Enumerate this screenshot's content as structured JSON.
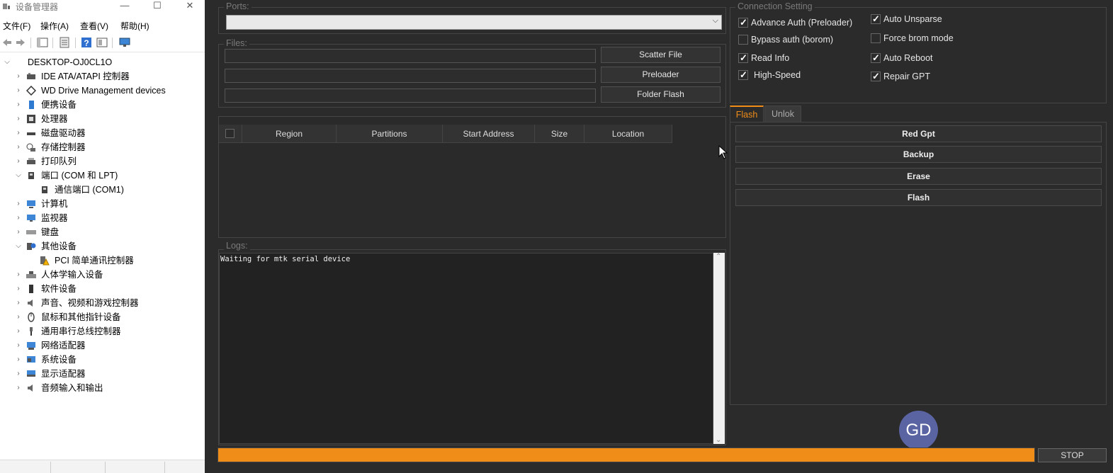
{
  "device_manager": {
    "title": "设备管理器",
    "window_buttons": {
      "minimize": "—",
      "maximize": "☐",
      "close": "✕"
    },
    "menu": [
      "文件(F)",
      "操作(A)",
      "查看(V)",
      "帮助(H)"
    ],
    "tree": [
      {
        "label": "DESKTOP-OJ0CL1O",
        "icon": "computer-icon",
        "expanded": true,
        "level": 0
      },
      {
        "label": "IDE ATA/ATAPI 控制器",
        "icon": "ide-icon",
        "level": 1
      },
      {
        "label": "WD Drive Management devices",
        "icon": "diamond-icon",
        "level": 1
      },
      {
        "label": "便携设备",
        "icon": "portable-device-icon",
        "level": 1
      },
      {
        "label": "处理器",
        "icon": "processor-icon",
        "level": 1
      },
      {
        "label": "磁盘驱动器",
        "icon": "disk-drive-icon",
        "level": 1
      },
      {
        "label": "存储控制器",
        "icon": "storage-controller-icon",
        "level": 1
      },
      {
        "label": "打印队列",
        "icon": "printer-icon",
        "level": 1
      },
      {
        "label": "端口 (COM 和 LPT)",
        "icon": "port-icon",
        "expanded": true,
        "level": 1
      },
      {
        "label": "通信端口 (COM1)",
        "icon": "com-port-icon",
        "level": 2
      },
      {
        "label": "计算机",
        "icon": "computer-icon",
        "level": 1
      },
      {
        "label": "监视器",
        "icon": "monitor-icon",
        "level": 1
      },
      {
        "label": "键盘",
        "icon": "keyboard-icon",
        "level": 1
      },
      {
        "label": "其他设备",
        "icon": "unknown-device-icon",
        "expanded": true,
        "level": 1
      },
      {
        "label": "PCI 简单通讯控制器",
        "icon": "warning-device-icon",
        "level": 2
      },
      {
        "label": "人体学输入设备",
        "icon": "hid-icon",
        "level": 1
      },
      {
        "label": "软件设备",
        "icon": "software-device-icon",
        "level": 1
      },
      {
        "label": "声音、视频和游戏控制器",
        "icon": "speaker-icon",
        "level": 1
      },
      {
        "label": "鼠标和其他指针设备",
        "icon": "mouse-icon",
        "level": 1
      },
      {
        "label": "通用串行总线控制器",
        "icon": "usb-icon",
        "level": 1
      },
      {
        "label": "网络适配器",
        "icon": "network-icon",
        "level": 1
      },
      {
        "label": "系统设备",
        "icon": "system-device-icon",
        "level": 1
      },
      {
        "label": "显示适配器",
        "icon": "display-adapter-icon",
        "level": 1
      },
      {
        "label": "音频输入和输出",
        "icon": "audio-icon",
        "level": 1
      }
    ]
  },
  "tool": {
    "ports": {
      "title": "Ports:",
      "selected": ""
    },
    "files": {
      "title": "Files:",
      "rows": [
        {
          "value": "",
          "button": "Scatter File"
        },
        {
          "value": "",
          "button": "Preloader"
        },
        {
          "value": "",
          "button": "Folder Flash"
        }
      ]
    },
    "partitions_table": {
      "columns": [
        "Region",
        "Partitions",
        "Start Address",
        "Size",
        "Location"
      ]
    },
    "logs": {
      "title": "Logs:",
      "lines": [
        "Waiting for mtk serial device"
      ]
    },
    "connection": {
      "title": "Connection Setting",
      "options": [
        {
          "label": "Advance Auth (Preloader)",
          "checked": true
        },
        {
          "label": "Auto Unsparse",
          "checked": true
        },
        {
          "label": "Bypass auth (borom)",
          "checked": false
        },
        {
          "label": "Force brom mode",
          "checked": false
        },
        {
          "label": "Read Info",
          "checked": true
        },
        {
          "label": "Auto Reboot",
          "checked": true
        },
        {
          "label": "High-Speed",
          "checked": true
        },
        {
          "label": "Repair GPT",
          "checked": true
        }
      ]
    },
    "tabs": [
      {
        "label": "Flash",
        "active": true
      },
      {
        "label": "Unlok",
        "active": false
      }
    ],
    "actions": [
      "Red Gpt",
      "Backup",
      "Erase",
      "Flash"
    ],
    "avatar": "GD",
    "progress": {
      "percent": 100,
      "color": "#f08d18"
    },
    "stop": "STOP"
  }
}
